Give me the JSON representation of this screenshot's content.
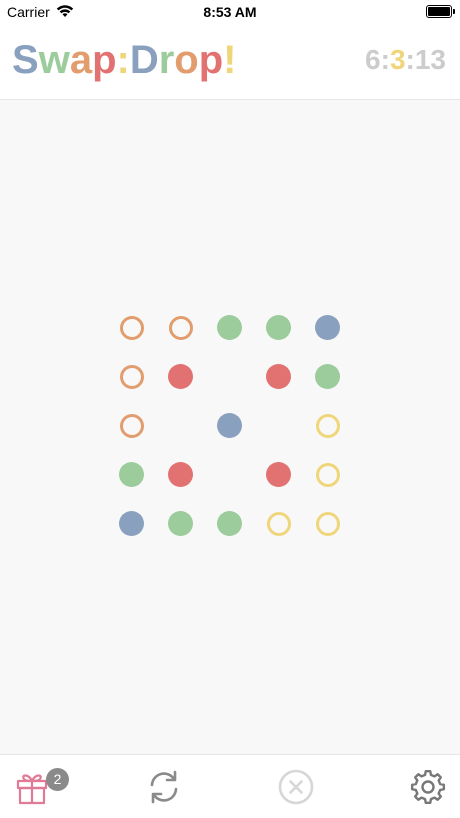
{
  "status_bar": {
    "carrier": "Carrier",
    "time": "8:53 AM"
  },
  "header": {
    "logo_letters": [
      {
        "char": "S",
        "color": "#8aa0bf"
      },
      {
        "char": "w",
        "color": "#9ccc9c"
      },
      {
        "char": "a",
        "color": "#e29d6f"
      },
      {
        "char": "p",
        "color": "#e27272"
      },
      {
        "char": ":",
        "color": "#f0d67a"
      },
      {
        "char": "D",
        "color": "#8aa0bf"
      },
      {
        "char": "r",
        "color": "#9ccc9c"
      },
      {
        "char": "o",
        "color": "#e29d6f"
      },
      {
        "char": "p",
        "color": "#e27272"
      },
      {
        "char": "!",
        "color": "#f0d67a"
      }
    ],
    "timer_parts": [
      {
        "text": "6:",
        "color": "#cccccc"
      },
      {
        "text": "3",
        "color": "#f0d67a"
      },
      {
        "text": ":13",
        "color": "#cccccc"
      }
    ]
  },
  "colors": {
    "orange": "#e29d6f",
    "green": "#9ccc9c",
    "blue": "#8aa0bf",
    "red": "#e27272",
    "yellow": "#f0d67a"
  },
  "board": {
    "rows": 5,
    "cols": 5,
    "cells": [
      [
        {
          "color": "orange",
          "style": "ring"
        },
        {
          "color": "orange",
          "style": "ring"
        },
        {
          "color": "green",
          "style": "filled"
        },
        {
          "color": "green",
          "style": "filled"
        },
        {
          "color": "blue",
          "style": "filled"
        }
      ],
      [
        {
          "color": "orange",
          "style": "ring"
        },
        {
          "color": "red",
          "style": "filled"
        },
        null,
        {
          "color": "red",
          "style": "filled"
        },
        {
          "color": "green",
          "style": "filled"
        }
      ],
      [
        {
          "color": "orange",
          "style": "ring"
        },
        null,
        {
          "color": "blue",
          "style": "filled"
        },
        null,
        {
          "color": "yellow",
          "style": "ring"
        }
      ],
      [
        {
          "color": "green",
          "style": "filled"
        },
        {
          "color": "red",
          "style": "filled"
        },
        null,
        {
          "color": "red",
          "style": "filled"
        },
        {
          "color": "yellow",
          "style": "ring"
        }
      ],
      [
        {
          "color": "blue",
          "style": "filled"
        },
        {
          "color": "green",
          "style": "filled"
        },
        {
          "color": "green",
          "style": "filled"
        },
        {
          "color": "yellow",
          "style": "ring"
        },
        {
          "color": "yellow",
          "style": "ring"
        }
      ]
    ]
  },
  "toolbar": {
    "gift_badge_count": "2",
    "icons": [
      "gift-icon",
      "refresh-icon",
      "close-circle-icon",
      "gear-icon"
    ]
  }
}
